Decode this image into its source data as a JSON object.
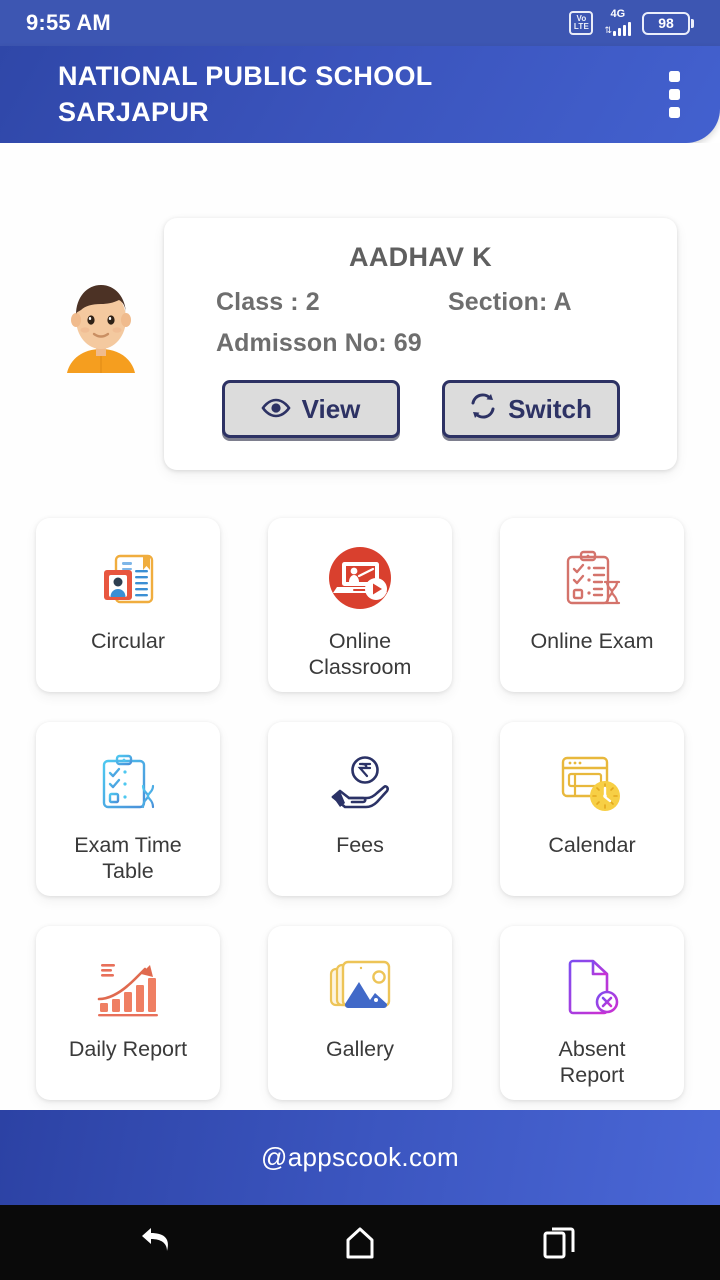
{
  "statusbar": {
    "time": "9:55 AM",
    "volte_top": "Vo",
    "volte_bottom": "LTE",
    "network": "4G",
    "signal_arrows": "⇅",
    "battery": "98"
  },
  "appbar": {
    "title": "NATIONAL PUBLIC SCHOOL SARJAPUR",
    "menu_icon": "kebab-menu-icon"
  },
  "student": {
    "avatar_icon": "boy-avatar",
    "name": "AADHAV K",
    "class_label": "Class : 2",
    "section_label": "Section: A",
    "admission_label": "Admisson No: 69",
    "view_button": "View",
    "view_icon": "eye-icon",
    "switch_button": "Switch",
    "switch_icon": "refresh-icon"
  },
  "tiles": [
    {
      "label": "Circular",
      "icon": "circular-document-icon"
    },
    {
      "label": "Online\nClassroom",
      "icon": "online-classroom-icon"
    },
    {
      "label": "Online Exam",
      "icon": "online-exam-clipboard-icon"
    },
    {
      "label": "Exam Time\nTable",
      "icon": "exam-timetable-clipboard-icon"
    },
    {
      "label": "Fees",
      "icon": "rupee-hand-icon"
    },
    {
      "label": "Calendar",
      "icon": "calendar-clock-icon"
    },
    {
      "label": "Daily Report",
      "icon": "growth-chart-icon"
    },
    {
      "label": "Gallery",
      "icon": "photo-stack-icon"
    },
    {
      "label": "Absent\nReport",
      "icon": "absent-document-icon"
    }
  ],
  "footer": {
    "text": "@appscook.com"
  },
  "navbar": {
    "back": "back-icon",
    "home": "home-icon",
    "recents": "recents-icon"
  },
  "colors": {
    "brand_blue": "#3b55bf",
    "statusbar_blue": "#3d56b2",
    "button_navy": "#2d3264",
    "page_bg": "#fefefe",
    "navbar_black": "#0a0a0a"
  }
}
